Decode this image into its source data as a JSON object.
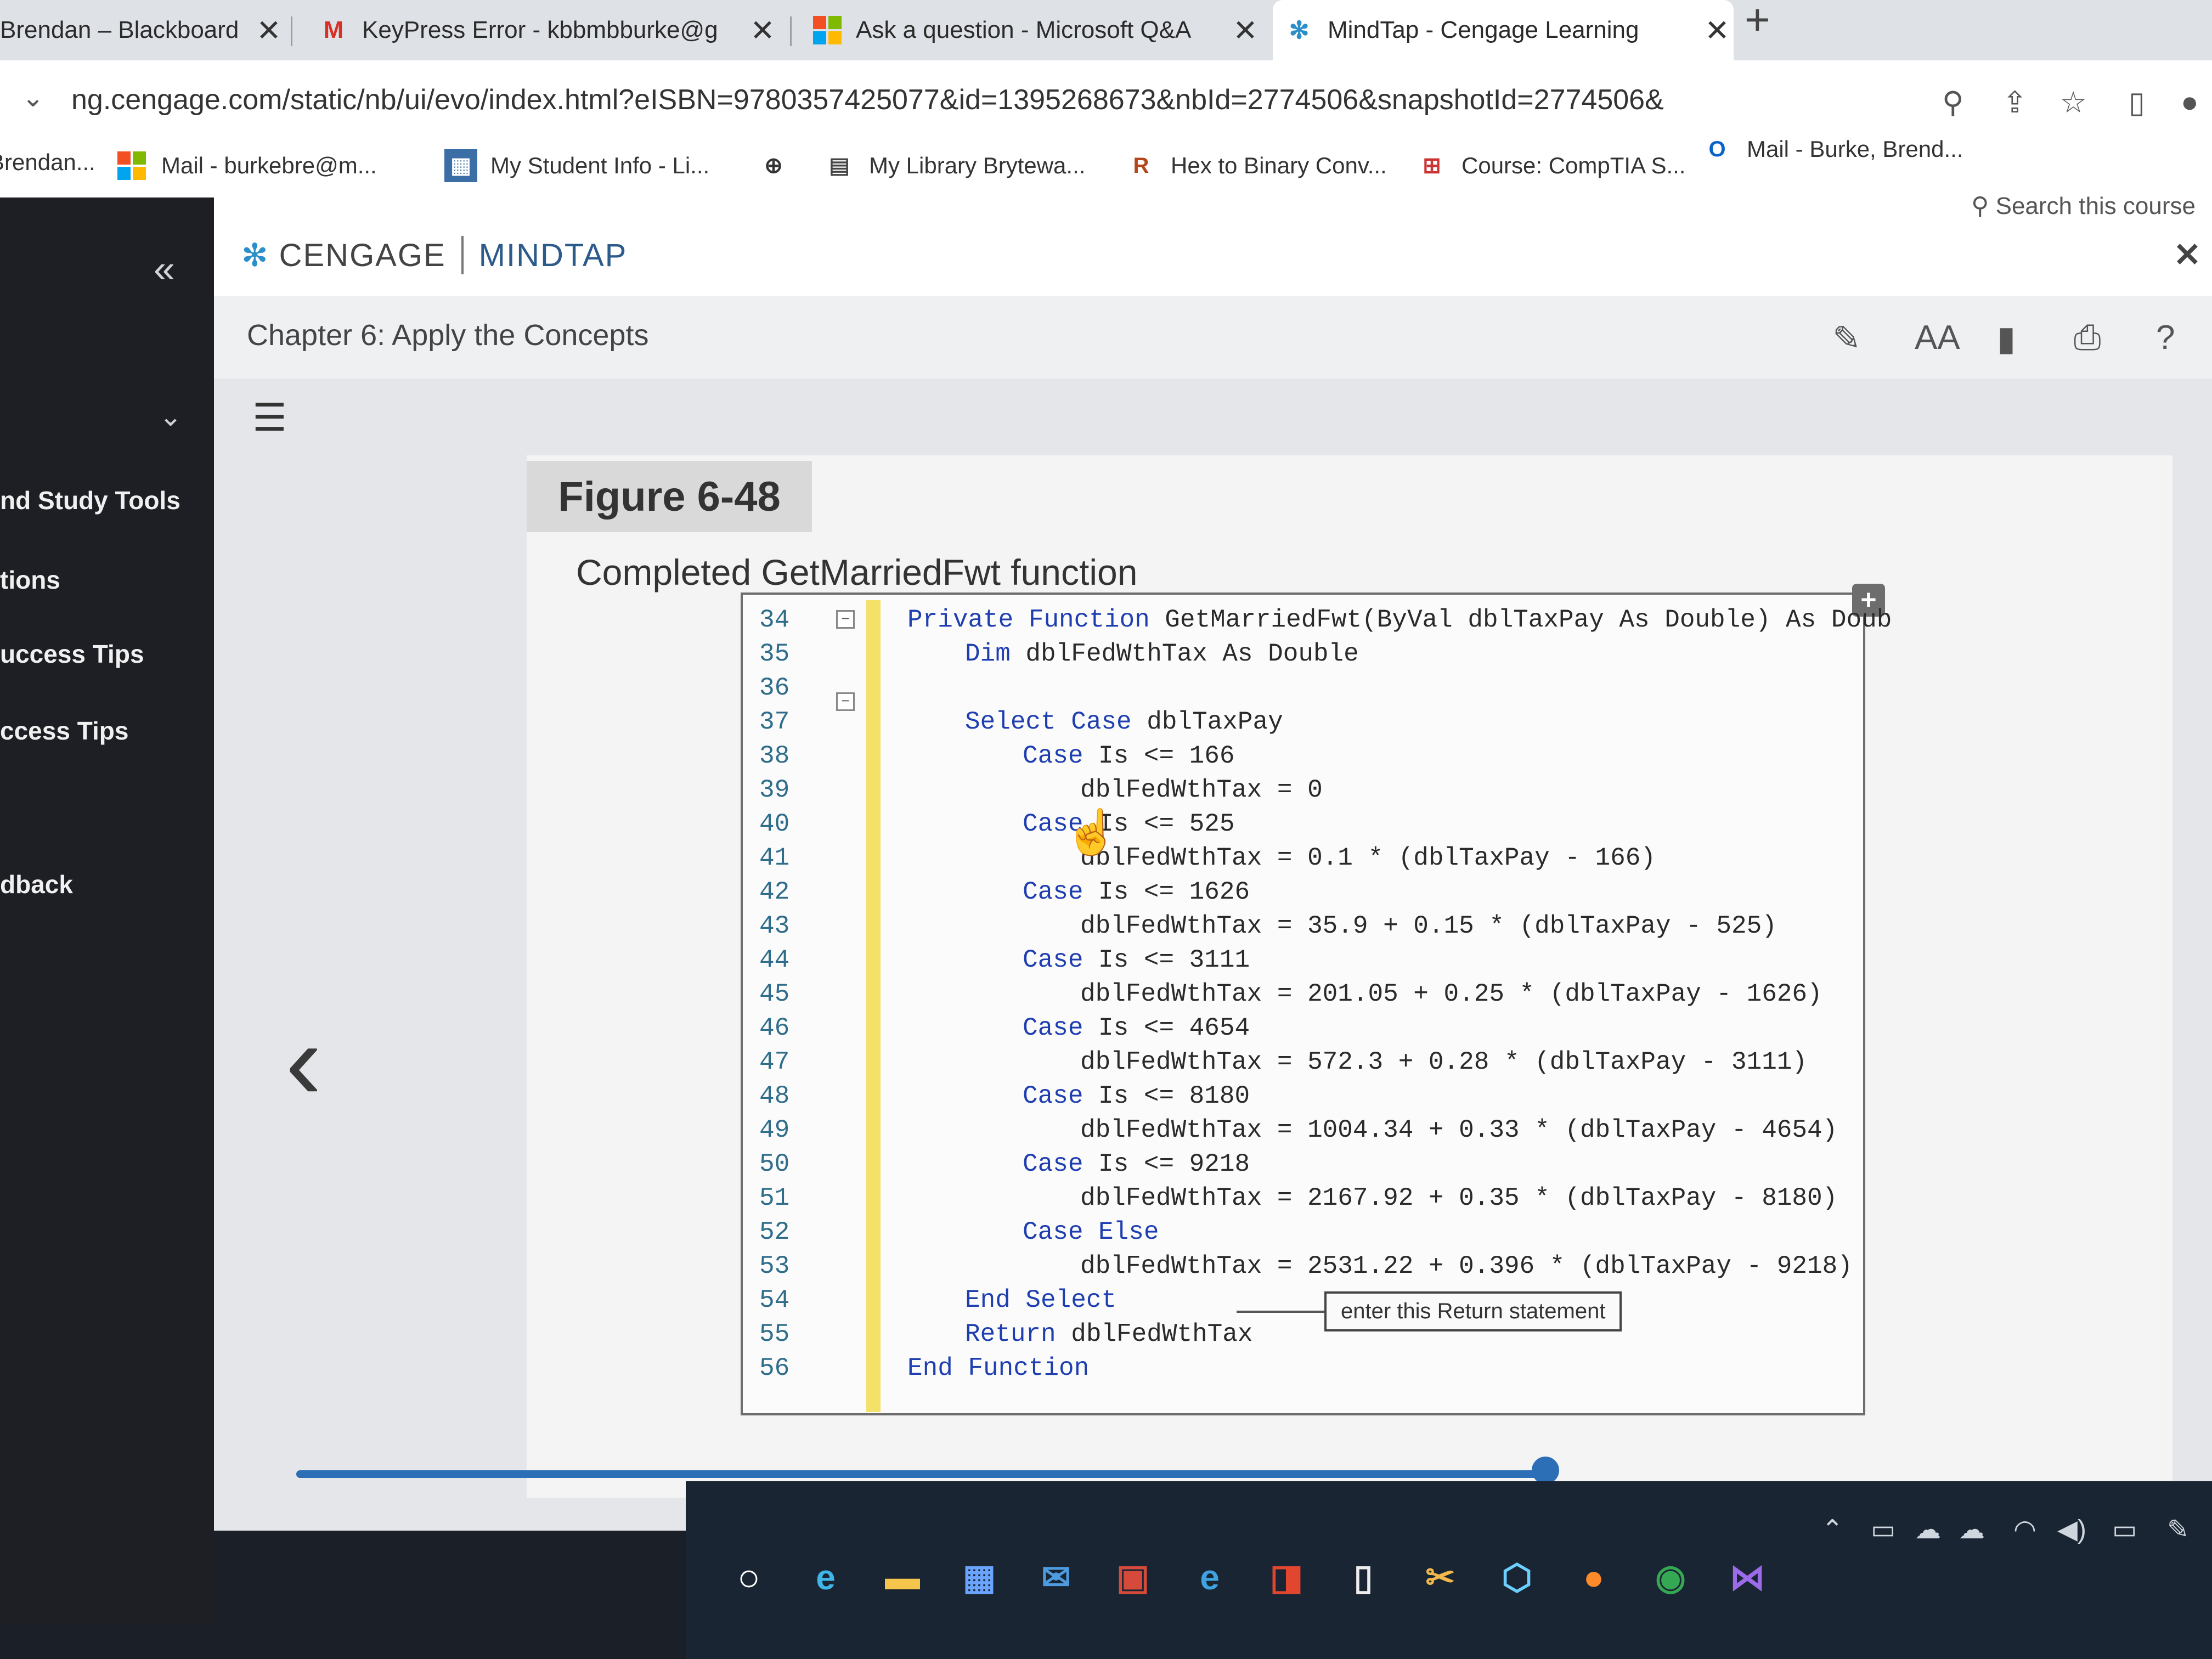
{
  "browser": {
    "tabs": [
      {
        "label": "Brendan – Blackboard",
        "icon": "blackboard-icon"
      },
      {
        "label": "KeyPress Error - kbbmbburke@g",
        "icon": "gmail-icon"
      },
      {
        "label": "Ask a question - Microsoft Q&A",
        "icon": "microsoft-icon"
      },
      {
        "label": "MindTap - Cengage Learning",
        "icon": "cengage-icon",
        "active": true
      }
    ],
    "url": "ng.cengage.com/static/nb/ui/evo/index.html?eISBN=9780357425077&id=1395268673&nbId=2774506&snapshotId=2774506&",
    "bookmarks": [
      {
        "label": "Brendan..."
      },
      {
        "label": "Mail - burkebre@m..."
      },
      {
        "label": "My Student Info - Li..."
      },
      {
        "label": ""
      },
      {
        "label": "My Library Brytewa..."
      },
      {
        "label": "Hex to Binary Conv..."
      },
      {
        "label": "Course: CompTIA S..."
      },
      {
        "label": "Mail - Burke, Brend..."
      }
    ]
  },
  "app": {
    "brand_left": "CENGAGE",
    "brand_right": "MINDTAP",
    "search_label": "Search this course",
    "chapter_title": "Chapter 6: Apply the Concepts",
    "sidebar_items": [
      "nd Study Tools",
      "tions",
      "uccess Tips",
      "ccess Tips",
      "dback"
    ]
  },
  "figure": {
    "label": "Figure 6-48",
    "caption": "Completed GetMarriedFwt function",
    "callout": "enter this Return statement",
    "line_numbers": [
      "34",
      "35",
      "36",
      "37",
      "38",
      "39",
      "40",
      "41",
      "42",
      "43",
      "44",
      "45",
      "46",
      "47",
      "48",
      "49",
      "50",
      "51",
      "52",
      "53",
      "54",
      "55",
      "56"
    ],
    "code_lines": [
      {
        "kw": "Private Function",
        "text": " GetMarriedFwt(ByVal dblTaxPay As Double) As Doub"
      },
      {
        "kw": "Dim",
        "text": " dblFedWthTax As Double"
      },
      {
        "kw": "",
        "text": ""
      },
      {
        "kw": "Select Case",
        "text": " dblTaxPay"
      },
      {
        "kw": "Case",
        "text": " Is <= 166"
      },
      {
        "kw": "",
        "text": "dblFedWthTax = 0"
      },
      {
        "kw": "Case",
        "text": " Is <= 525"
      },
      {
        "kw": "",
        "text": "dblFedWthTax = 0.1 * (dblTaxPay - 166)"
      },
      {
        "kw": "Case",
        "text": " Is <= 1626"
      },
      {
        "kw": "",
        "text": "dblFedWthTax = 35.9 + 0.15 * (dblTaxPay - 525)"
      },
      {
        "kw": "Case",
        "text": " Is <= 3111"
      },
      {
        "kw": "",
        "text": "dblFedWthTax = 201.05 + 0.25 * (dblTaxPay - 1626)"
      },
      {
        "kw": "Case",
        "text": " Is <= 4654"
      },
      {
        "kw": "",
        "text": "dblFedWthTax = 572.3 + 0.28 * (dblTaxPay - 3111)"
      },
      {
        "kw": "Case",
        "text": " Is <= 8180"
      },
      {
        "kw": "",
        "text": "dblFedWthTax = 1004.34 + 0.33 * (dblTaxPay - 4654)"
      },
      {
        "kw": "Case",
        "text": " Is <= 9218"
      },
      {
        "kw": "",
        "text": "dblFedWthTax = 2167.92 + 0.35 * (dblTaxPay - 8180)"
      },
      {
        "kw": "Case Else",
        "text": ""
      },
      {
        "kw": "",
        "text": "dblFedWthTax = 2531.22 + 0.396 * (dblTaxPay - 9218)"
      },
      {
        "kw": "End Select",
        "text": ""
      },
      {
        "kw": "Return",
        "text": " dblFedWthTax"
      },
      {
        "kw": "End Function",
        "text": ""
      }
    ]
  },
  "progress": {
    "fraction": 0.99
  },
  "colors": {
    "keyword": "#1f3fb0",
    "gutter": "#f3e16a",
    "progress": "#2d6fb6"
  }
}
